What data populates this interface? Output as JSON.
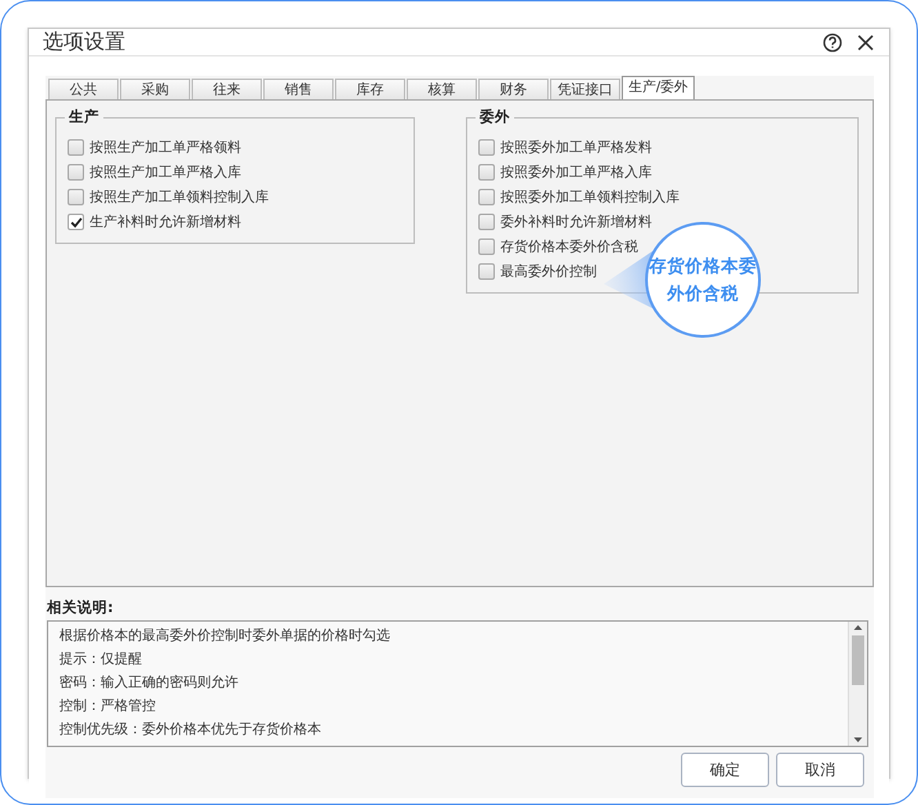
{
  "window": {
    "title": "选项设置"
  },
  "tabs": [
    {
      "label": "公共",
      "selected": false
    },
    {
      "label": "采购",
      "selected": false
    },
    {
      "label": "往来",
      "selected": false
    },
    {
      "label": "销售",
      "selected": false
    },
    {
      "label": "库存",
      "selected": false
    },
    {
      "label": "核算",
      "selected": false
    },
    {
      "label": "财务",
      "selected": false
    },
    {
      "label": "凭证接口",
      "selected": false
    },
    {
      "label": "生产/委外",
      "selected": true
    }
  ],
  "groups": [
    {
      "title": "生产",
      "options": [
        {
          "label": "按照生产加工单严格领料",
          "checked": false
        },
        {
          "label": "按照生产加工单严格入库",
          "checked": false
        },
        {
          "label": "按照生产加工单领料控制入库",
          "checked": false
        },
        {
          "label": "生产补料时允许新增材料",
          "checked": true
        }
      ]
    },
    {
      "title": "委外",
      "options": [
        {
          "label": "按照委外加工单严格发料",
          "checked": false
        },
        {
          "label": "按照委外加工单严格入库",
          "checked": false
        },
        {
          "label": "按照委外加工单领料控制入库",
          "checked": false
        },
        {
          "label": "委外补料时允许新增材料",
          "checked": false
        },
        {
          "label": "存货价格本委外价含税",
          "checked": false
        },
        {
          "label": "最高委外价控制",
          "checked": false
        }
      ]
    }
  ],
  "callout": {
    "text": "存货价格本委外价含税"
  },
  "description": {
    "label": "相关说明:",
    "lines": [
      "根据价格本的最高委外价控制时委外单据的价格时勾选",
      "提示：仅提醒",
      "密码：输入正确的密码则允许",
      "控制：严格管控",
      "控制优先级：委外价格本优先于存货价格本"
    ]
  },
  "buttons": [
    "确定",
    "取消"
  ]
}
